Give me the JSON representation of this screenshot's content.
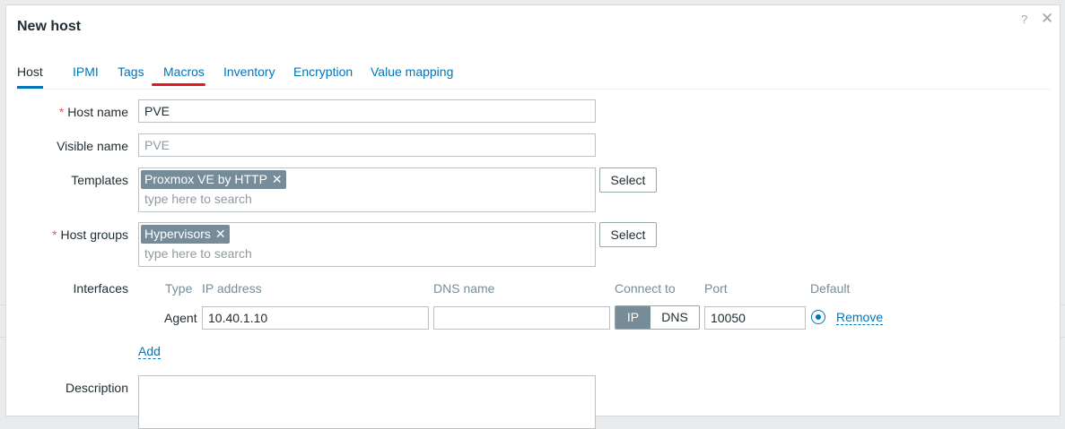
{
  "dialog": {
    "title": "New host",
    "help_icon": "question-icon",
    "close_icon": "close-icon"
  },
  "tabs": [
    {
      "label": "Host",
      "active": true
    },
    {
      "label": "IPMI"
    },
    {
      "label": "Tags"
    },
    {
      "label": "Macros",
      "highlighted": true
    },
    {
      "label": "Inventory"
    },
    {
      "label": "Encryption"
    },
    {
      "label": "Value mapping"
    }
  ],
  "form": {
    "required_mark": "*",
    "host_name": {
      "label": "Host name",
      "value": "PVE"
    },
    "visible_name": {
      "label": "Visible name",
      "placeholder": "PVE"
    },
    "templates": {
      "label": "Templates",
      "selected": [
        "Proxmox VE by HTTP"
      ],
      "placeholder": "type here to search",
      "select_button": "Select"
    },
    "host_groups": {
      "label": "Host groups",
      "selected": [
        "Hypervisors"
      ],
      "placeholder": "type here to search",
      "select_button": "Select"
    },
    "interfaces": {
      "label": "Interfaces",
      "columns": [
        "Type",
        "IP address",
        "DNS name",
        "Connect to",
        "Port",
        "Default"
      ],
      "rows": [
        {
          "type": "Agent",
          "ip": "10.40.1.10",
          "dns": "",
          "connect_ip": "IP",
          "connect_dns": "DNS",
          "connect_selected": "IP",
          "port": "10050",
          "default": true,
          "remove": "Remove"
        }
      ],
      "add_link": "Add"
    },
    "description": {
      "label": "Description",
      "value": ""
    }
  },
  "colors": {
    "accent": "#0275b8",
    "chip": "#768d99",
    "required": "#e45959",
    "annotation_red": "#e8161f"
  }
}
